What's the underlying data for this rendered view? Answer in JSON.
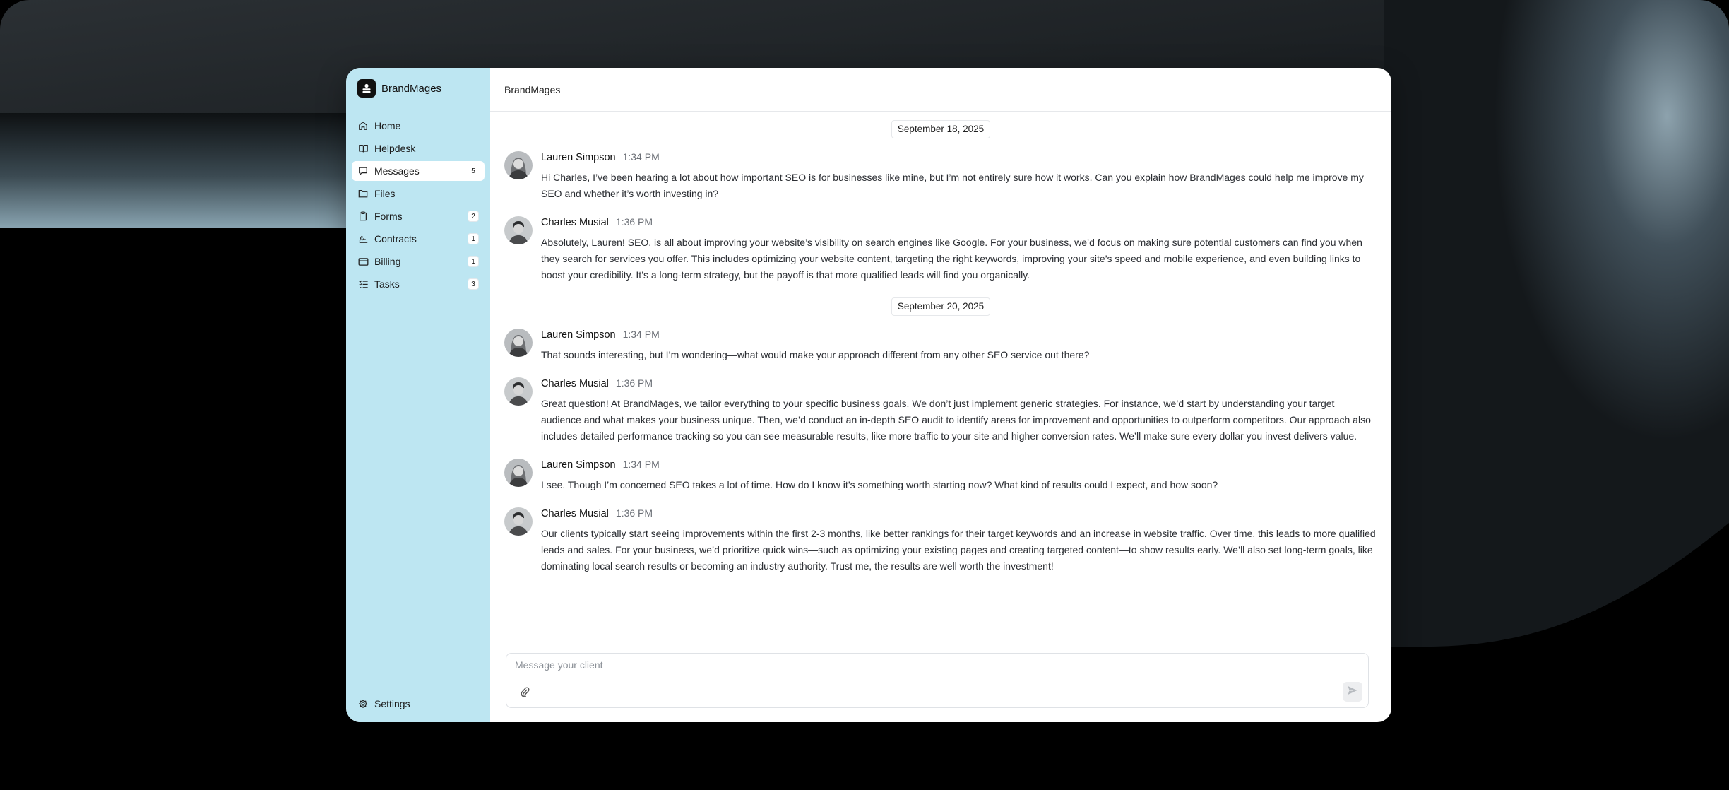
{
  "app": {
    "brand": "BrandMages",
    "header_title": "BrandMages"
  },
  "sidebar": {
    "items": [
      {
        "label": "Home",
        "icon": "home-icon",
        "badge": ""
      },
      {
        "label": "Helpdesk",
        "icon": "book-icon",
        "badge": ""
      },
      {
        "label": "Messages",
        "icon": "message-icon",
        "badge": "5",
        "active": true
      },
      {
        "label": "Files",
        "icon": "folder-icon",
        "badge": ""
      },
      {
        "label": "Forms",
        "icon": "clipboard-icon",
        "badge": "2"
      },
      {
        "label": "Contracts",
        "icon": "signature-icon",
        "badge": "1"
      },
      {
        "label": "Billing",
        "icon": "credit-card-icon",
        "badge": "1"
      },
      {
        "label": "Tasks",
        "icon": "checklist-icon",
        "badge": "3"
      }
    ],
    "settings_label": "Settings"
  },
  "thread": [
    {
      "type": "date",
      "label": "September 18, 2025"
    },
    {
      "type": "message",
      "name": "Lauren Simpson",
      "time": "1:34 PM",
      "avatar": "lauren",
      "text": "Hi Charles, I’ve been hearing a lot about how important SEO is for businesses like mine, but I’m not entirely sure how it works. Can you explain how BrandMages could help me improve my SEO and whether it’s worth investing in?"
    },
    {
      "type": "message",
      "name": "Charles Musial",
      "time": "1:36 PM",
      "avatar": "charles",
      "text": "Absolutely, Lauren! SEO, is all about improving your website’s visibility on search engines like Google. For your business, we’d focus on making sure potential customers can find you when they search for services you offer. This includes optimizing your website content, targeting the right keywords, improving your site’s speed and mobile experience, and even building links to boost your credibility. It’s a long-term strategy, but the payoff is that more qualified leads will find you organically."
    },
    {
      "type": "date",
      "label": "September 20, 2025"
    },
    {
      "type": "message",
      "name": "Lauren Simpson",
      "time": "1:34 PM",
      "avatar": "lauren",
      "text": "That sounds interesting, but I’m wondering—what would make your approach different from any other SEO service out there?"
    },
    {
      "type": "message",
      "name": "Charles Musial",
      "time": "1:36 PM",
      "avatar": "charles",
      "text": "Great question! At BrandMages, we tailor everything to your specific business goals. We don’t just implement generic strategies. For instance, we’d start by understanding your target audience and what makes your business unique. Then, we’d conduct an in-depth SEO audit to identify areas for improvement and opportunities to outperform competitors. Our approach also includes detailed performance tracking so you can see measurable results, like more traffic to your site and higher conversion rates. We’ll make sure every dollar you invest delivers value."
    },
    {
      "type": "message",
      "name": "Lauren Simpson",
      "time": "1:34 PM",
      "avatar": "lauren",
      "text": "I see. Though I’m concerned SEO takes a lot of time. How do I know it’s something worth starting now? What kind of results could I expect, and how soon?"
    },
    {
      "type": "message",
      "name": "Charles Musial",
      "time": "1:36 PM",
      "avatar": "charles",
      "text": "Our clients typically start seeing improvements within the first 2-3 months, like better rankings for their target keywords and an increase in website traffic. Over time, this leads to more qualified leads and sales. For your business, we’d prioritize quick wins—such as optimizing your existing pages and creating targeted content—to show results early. We’ll also set long-term goals, like dominating local search results or becoming an industry authority. Trust me, the results are well worth the investment!"
    }
  ],
  "composer": {
    "placeholder": "Message your client",
    "value": ""
  }
}
